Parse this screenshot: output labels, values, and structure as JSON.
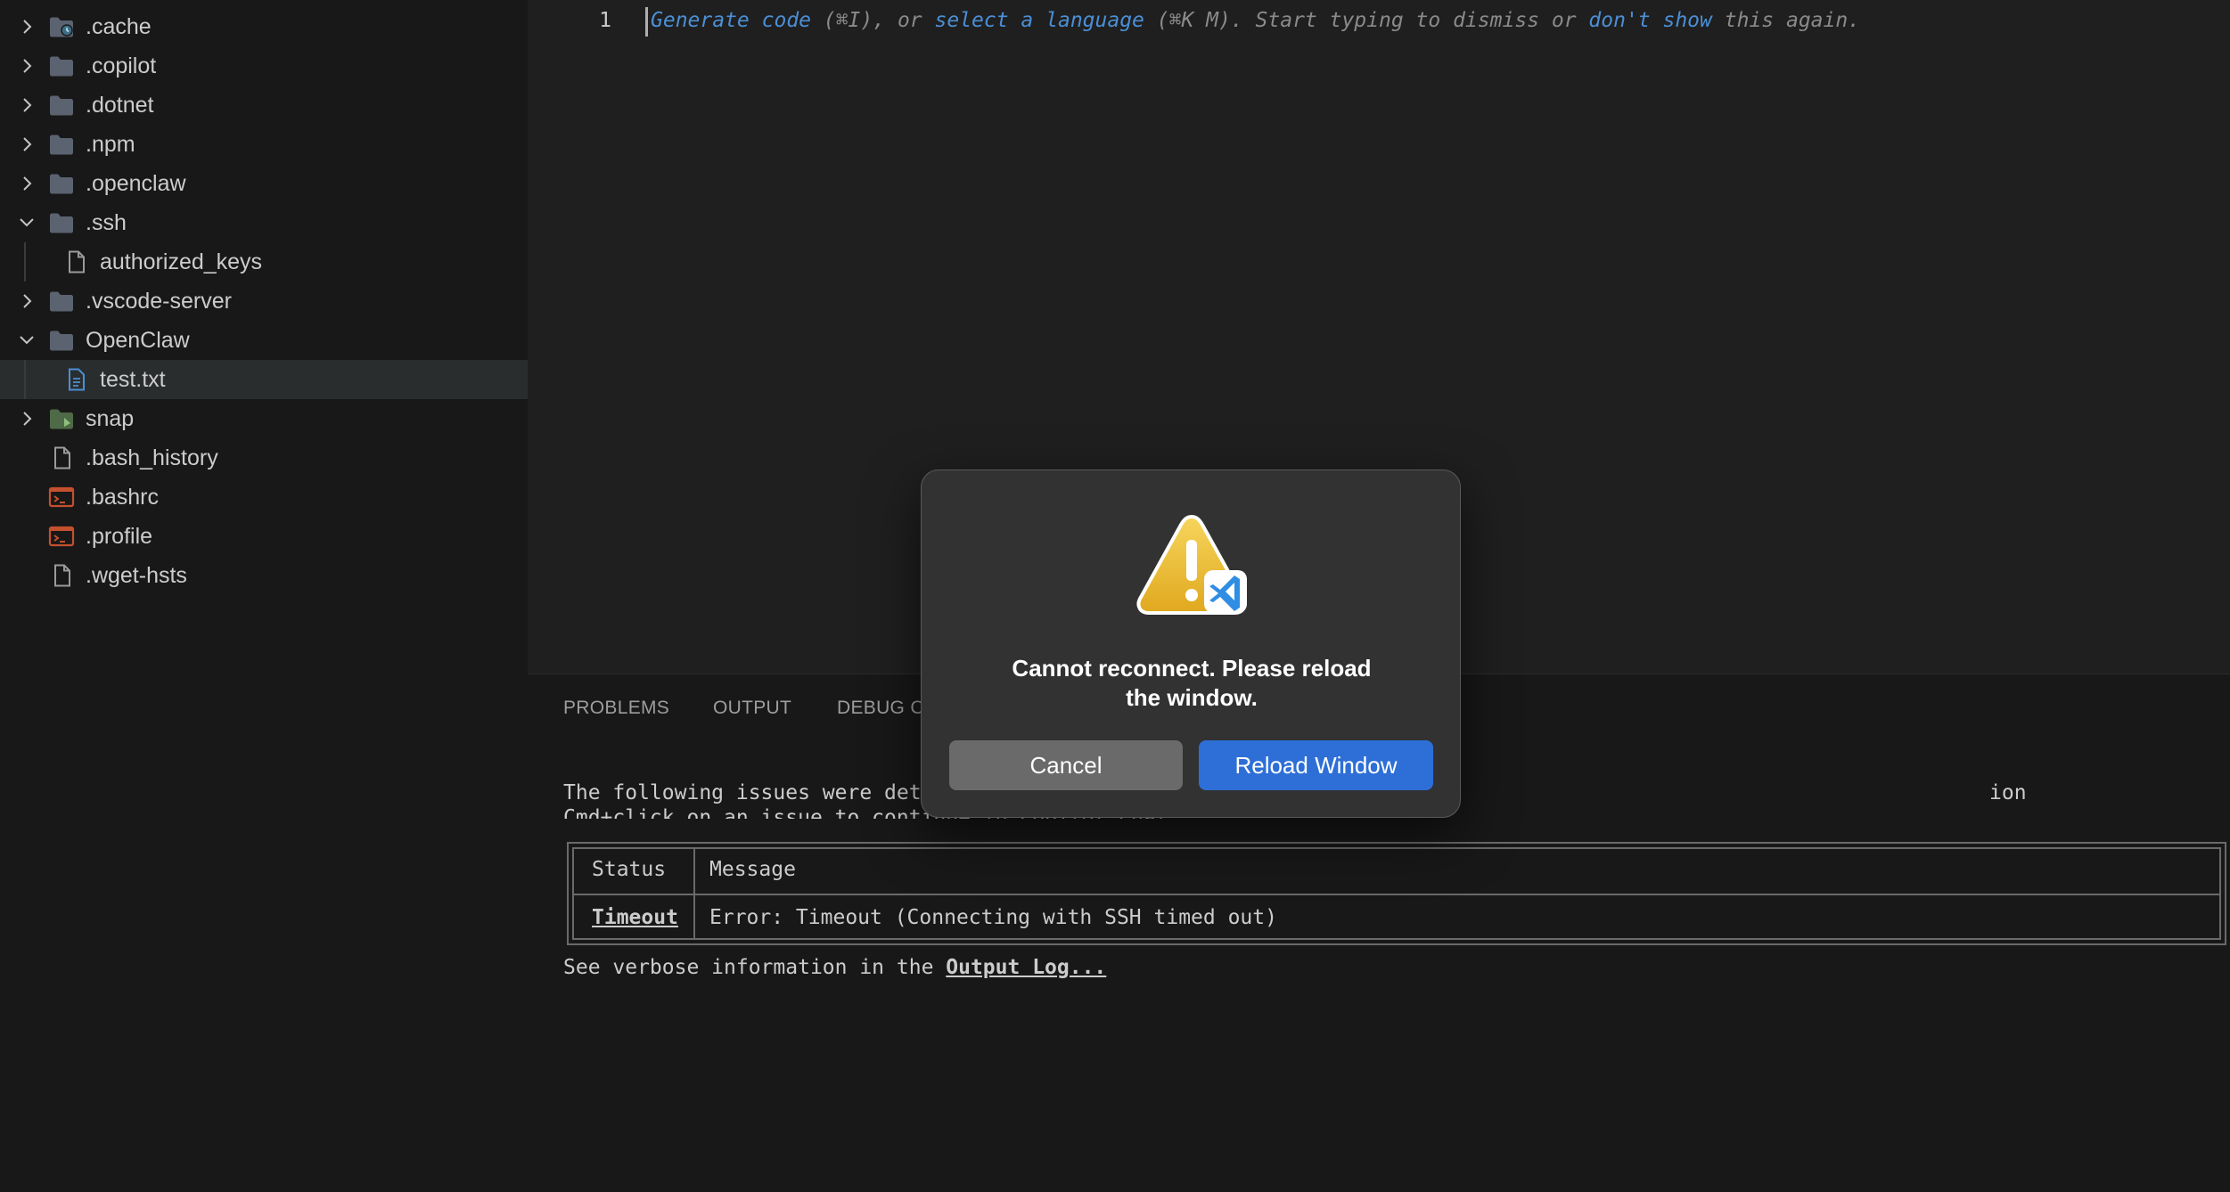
{
  "explorer": {
    "items": [
      {
        "label": ".cache",
        "kind": "folder-special",
        "depth": 0,
        "state": "collapsed"
      },
      {
        "label": ".copilot",
        "kind": "folder",
        "depth": 0,
        "state": "collapsed"
      },
      {
        "label": ".dotnet",
        "kind": "folder",
        "depth": 0,
        "state": "collapsed"
      },
      {
        "label": ".npm",
        "kind": "folder",
        "depth": 0,
        "state": "collapsed"
      },
      {
        "label": ".openclaw",
        "kind": "folder",
        "depth": 0,
        "state": "collapsed"
      },
      {
        "label": ".ssh",
        "kind": "folder",
        "depth": 0,
        "state": "expanded"
      },
      {
        "label": "authorized_keys",
        "kind": "file",
        "depth": 1,
        "state": "none"
      },
      {
        "label": ".vscode-server",
        "kind": "folder",
        "depth": 0,
        "state": "collapsed"
      },
      {
        "label": "OpenClaw",
        "kind": "folder",
        "depth": 0,
        "state": "expanded"
      },
      {
        "label": "test.txt",
        "kind": "text-file",
        "depth": 1,
        "state": "none",
        "selected": true
      },
      {
        "label": "snap",
        "kind": "folder-green",
        "depth": 0,
        "state": "collapsed"
      },
      {
        "label": ".bash_history",
        "kind": "file",
        "depth": 0,
        "state": "none"
      },
      {
        "label": ".bashrc",
        "kind": "shell-file",
        "depth": 0,
        "state": "none"
      },
      {
        "label": ".profile",
        "kind": "shell-file",
        "depth": 0,
        "state": "none"
      },
      {
        "label": ".wget-hsts",
        "kind": "file",
        "depth": 0,
        "state": "none"
      }
    ]
  },
  "editor": {
    "line_number": "1",
    "hint": {
      "generate": "Generate code",
      "generate_key": " (⌘I), or ",
      "select_language": "select a language",
      "language_key": " (⌘K M). Start typing to dismiss or ",
      "dont_show": "don't show",
      "tail": " this again."
    }
  },
  "panel": {
    "tabs": {
      "problems": "PROBLEMS",
      "output": "OUTPUT",
      "debug": "DEBUG C"
    },
    "line1_start": "The following issues were det",
    "line1_end": "ion",
    "line2_partial": "Cmd+click on an issue to continue in Copilot Chat.",
    "table": {
      "header_status": "Status",
      "header_message": "Message",
      "row_status": "Timeout",
      "row_message": "Error: Timeout (Connecting with SSH timed out)"
    },
    "verbose_prefix": "See verbose information in the ",
    "verbose_link": "Output Log..."
  },
  "dialog": {
    "message_line1": "Cannot reconnect. Please reload",
    "message_line2": "the window.",
    "cancel_label": "Cancel",
    "reload_label": "Reload Window"
  },
  "colors": {
    "accent": "#2d6fd6",
    "link": "#4b8fd6",
    "folder": "#5b6270",
    "shell": "#c4502e"
  }
}
